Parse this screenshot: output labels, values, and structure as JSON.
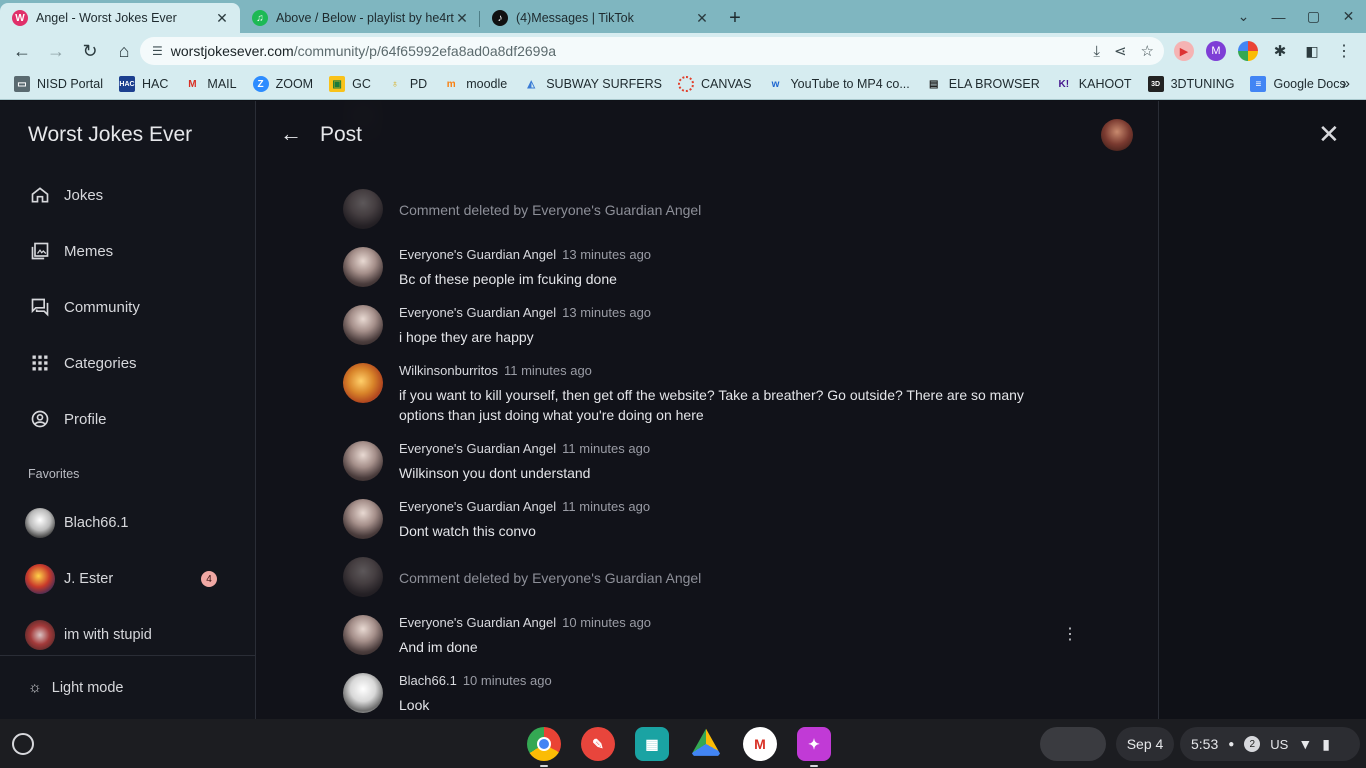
{
  "browser": {
    "tabs": [
      {
        "title": "Angel - Worst Jokes Ever",
        "favicon": "W",
        "favicon_color": "#e0306a",
        "active": true
      },
      {
        "title": "Above / Below - playlist by he4rt",
        "favicon": "♫",
        "favicon_color": "#1db954",
        "active": false
      },
      {
        "title": "(4)Messages | TikTok",
        "favicon": "♪",
        "favicon_color": "#111111",
        "active": false
      }
    ],
    "url_domain": "worstjokesever.com",
    "url_path": "/community/p/64f65992efa8ad0a8df2699a",
    "bookmarks": [
      {
        "label": "NISD Portal",
        "icon": "folder-icon"
      },
      {
        "label": "HAC",
        "icon": "hac-icon"
      },
      {
        "label": "MAIL",
        "icon": "gmail-icon"
      },
      {
        "label": "ZOOM",
        "icon": "zoom-icon"
      },
      {
        "label": "GC",
        "icon": "classroom-icon"
      },
      {
        "label": "PD",
        "icon": "pd-icon"
      },
      {
        "label": "moodle",
        "icon": "moodle-icon"
      },
      {
        "label": "SUBWAY SURFERS",
        "icon": "subway-icon"
      },
      {
        "label": "CANVAS",
        "icon": "canvas-icon"
      },
      {
        "label": "YouTube to MP4 co...",
        "icon": "w-icon"
      },
      {
        "label": "ELA BROWSER",
        "icon": "book-icon"
      },
      {
        "label": "KAHOOT",
        "icon": "kahoot-icon"
      },
      {
        "label": "3DTUNING",
        "icon": "3dt-icon"
      },
      {
        "label": "Google Docs",
        "icon": "docs-icon"
      }
    ]
  },
  "sidebar": {
    "site_title": "Worst Jokes Ever",
    "nav": [
      {
        "label": "Jokes",
        "icon": "home-icon"
      },
      {
        "label": "Memes",
        "icon": "images-icon"
      },
      {
        "label": "Community",
        "icon": "chat-icon"
      },
      {
        "label": "Categories",
        "icon": "grid-icon"
      },
      {
        "label": "Profile",
        "icon": "account-icon"
      }
    ],
    "favorites_heading": "Favorites",
    "favorites": [
      {
        "name": "Blach66.1",
        "badge": ""
      },
      {
        "name": "J. Ester",
        "badge": "4"
      },
      {
        "name": "im with stupid",
        "badge": ""
      }
    ],
    "light_mode_label": "Light mode"
  },
  "post": {
    "title": "Post",
    "comments": [
      {
        "deleted": true,
        "text": "Comment deleted by Everyone's Guardian Angel"
      },
      {
        "author": "Everyone's Guardian Angel",
        "time": "13 minutes ago",
        "text": "Bc of these people im fcuking done"
      },
      {
        "author": "Everyone's Guardian Angel",
        "time": "13 minutes ago",
        "text": "i hope they are happy"
      },
      {
        "author": "Wilkinsonburritos",
        "time": "11 minutes ago",
        "text": "if you want to kill yourself, then get off the website? Take a breather? Go outside? There are so many options than just doing what you're doing on here"
      },
      {
        "author": "Everyone's Guardian Angel",
        "time": "11 minutes ago",
        "text": "Wilkinson you dont understand"
      },
      {
        "author": "Everyone's Guardian Angel",
        "time": "11 minutes ago",
        "text": "Dont watch this convo"
      },
      {
        "deleted": true,
        "text": "Comment deleted by Everyone's Guardian Angel"
      },
      {
        "author": "Everyone's Guardian Angel",
        "time": "10 minutes ago",
        "text": "And im done"
      },
      {
        "author": "Blach66.1",
        "time": "10 minutes ago",
        "text": "Look"
      }
    ]
  },
  "shelf": {
    "date": "Sep 4",
    "time": "5:53",
    "notifications": "2",
    "input_method": "US"
  }
}
